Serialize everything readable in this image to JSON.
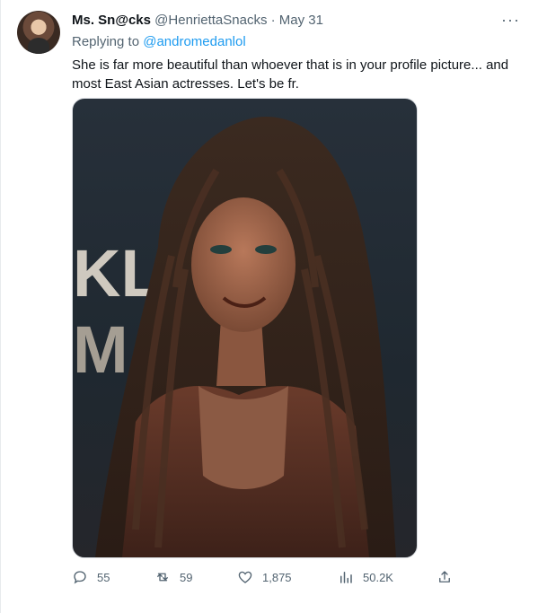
{
  "tweet": {
    "name": "Ms. Sn@cks",
    "handle": "@HenriettaSnacks",
    "dot": "·",
    "date": "May 31",
    "more": "···",
    "reply_prefix": "Replying to ",
    "reply_handle": "@andromedanlol",
    "text": "She is far more beautiful than whoever that is in your profile picture... and most East Asian actresses. Let's be fr.",
    "media_backdrop_letters": [
      "KL",
      "M"
    ]
  },
  "actions": {
    "replies": "55",
    "retweets": "59",
    "likes": "1,875",
    "views": "50.2K"
  },
  "icons": {
    "reply": "reply-icon",
    "retweet": "retweet-icon",
    "like": "heart-icon",
    "views": "views-icon",
    "share": "share-icon",
    "more": "more-icon"
  },
  "colors": {
    "accent": "#1d9bf0",
    "text": "#0f1419",
    "muted": "#536471"
  }
}
